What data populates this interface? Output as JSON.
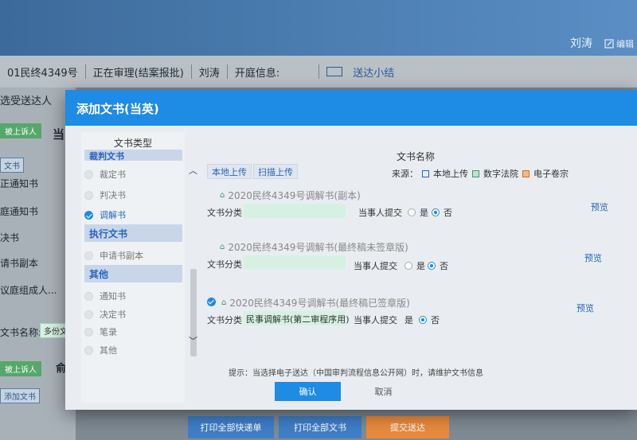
{
  "header": {
    "user_name": "刘涛",
    "edit_label": "编辑"
  },
  "case_bar": {
    "case_no": "01民终4349号",
    "status": "正在审理(结案报批)",
    "judge": "刘涛",
    "hearing_label": "开庭信息:",
    "delivery_summary": "送达小结"
  },
  "background": {
    "select_recipient": "选受送达人",
    "appellee_tag": "被上诉人",
    "party_title_1": "当",
    "doc_tag": "文书",
    "items": [
      "正通知书",
      "庭通知书",
      "决书",
      "请书副本",
      "议庭组成人..."
    ],
    "doc_name_label": "文书名称:",
    "doc_name_value": "多份文书",
    "appellee_tag_2": "被上诉人",
    "party_title_2": "俞",
    "add_doc": "添加文书",
    "footer_buttons": [
      "打印全部快递单",
      "打印全部文书",
      "提交送达"
    ]
  },
  "modal": {
    "title": "添加文书(当英)",
    "left_header": "文书类型",
    "groups": [
      {
        "label": "裁判文书"
      },
      {
        "label": "执行文书"
      },
      {
        "label": "其他"
      }
    ],
    "items": [
      {
        "label": "裁定书",
        "selected": false
      },
      {
        "label": "判决书",
        "selected": false
      },
      {
        "label": "调解书",
        "selected": true
      },
      {
        "label": "申请书副本",
        "selected": false
      },
      {
        "label": "通知书",
        "selected": false
      },
      {
        "label": "决定书",
        "selected": false
      },
      {
        "label": "笔录",
        "selected": false
      },
      {
        "label": "其他",
        "selected": false
      }
    ],
    "right_header": "文书名称",
    "local_upload": "本地上传",
    "scan_upload": "扫描上传",
    "source_label": "来源：",
    "sources": [
      "本地上传",
      "数字法院",
      "电子卷宗"
    ],
    "docs": [
      {
        "name": "2020民终4349号调解书(副本)",
        "category_label": "文书分类",
        "category_value": "",
        "party_submit_label": "当事人提交",
        "yes": "是",
        "no": "否",
        "submitted": false,
        "checked": false,
        "preview": "预览"
      },
      {
        "name": "2020民终4349号调解书(最终稿未签章版)",
        "category_label": "文书分类",
        "category_value": "",
        "party_submit_label": "当事人提交",
        "yes": "是",
        "no": "否",
        "submitted": false,
        "checked": false,
        "preview": "预览"
      },
      {
        "name": "2020民终4349号调解书(最终稿已签章版)",
        "category_label": "文书分类",
        "category_value": "民事调解书(第二审程序用)",
        "party_submit_label": "当事人提交",
        "yes": "是",
        "no": "否",
        "submitted": false,
        "checked": true,
        "preview": "预览"
      }
    ],
    "tip": "提示：当选择电子送达（中国审判流程信息公开网）时，请维护文书信息",
    "confirm": "确认",
    "cancel": "取消"
  },
  "colors": {
    "accent": "#1e8be4",
    "green_tag": "#55a76a",
    "orange_button": "#e98a3e"
  }
}
